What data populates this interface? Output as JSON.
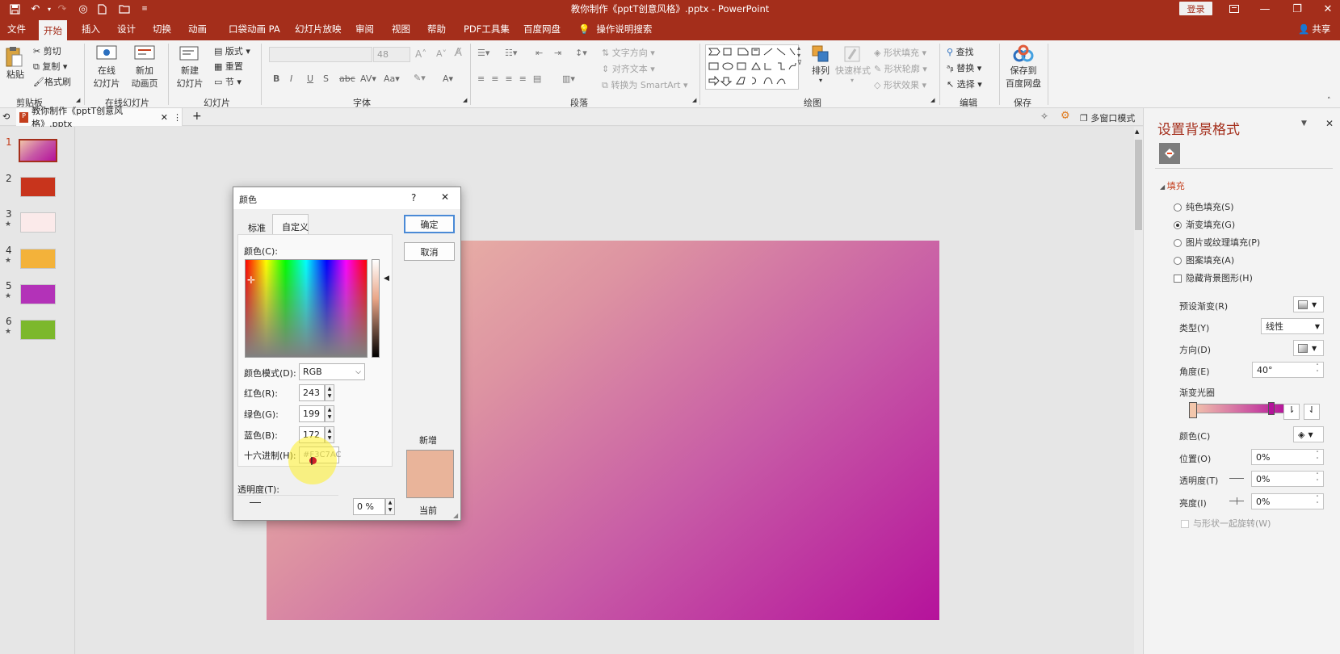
{
  "titlebar": {
    "title": "教你制作《pptT创意风格》.pptx  -  PowerPoint",
    "login": "登录"
  },
  "tabs": [
    {
      "label": "文件"
    },
    {
      "label": "开始"
    },
    {
      "label": "插入"
    },
    {
      "label": "设计"
    },
    {
      "label": "切换"
    },
    {
      "label": "动画"
    },
    {
      "label": "口袋动画 PA"
    },
    {
      "label": "幻灯片放映"
    },
    {
      "label": "审阅"
    },
    {
      "label": "视图"
    },
    {
      "label": "帮助"
    },
    {
      "label": "PDF工具集"
    },
    {
      "label": "百度网盘"
    }
  ],
  "tell_me": "操作说明搜索",
  "share": "共享",
  "ribbon": {
    "clipboard": {
      "paste": "粘贴",
      "cut": "剪切",
      "copy": "复制",
      "format_painter": "格式刷",
      "group": "剪贴板"
    },
    "online": {
      "online_slides_1": "在线",
      "online_slides_2": "幻灯片",
      "new_anim_1": "新加",
      "new_anim_2": "动画页",
      "group": "在线幻灯片"
    },
    "slides": {
      "new_slide_1": "新建",
      "new_slide_2": "幻灯片",
      "layout": "版式",
      "reset": "重置",
      "section": "节",
      "group": "幻灯片"
    },
    "font": {
      "size": "48",
      "group": "字体"
    },
    "paragraph": {
      "text_direction": "文字方向",
      "align_text": "对齐文本",
      "smartart": "转换为 SmartArt",
      "group": "段落"
    },
    "drawing": {
      "arrange": "排列",
      "quick_styles": "快速样式",
      "shape_fill": "形状填充",
      "shape_outline": "形状轮廓",
      "shape_effects": "形状效果",
      "group": "绘图"
    },
    "editing": {
      "find": "查找",
      "replace": "替换",
      "select": "选择",
      "group": "编辑"
    },
    "save": {
      "label_1": "保存到",
      "label_2": "百度网盘",
      "group": "保存"
    }
  },
  "doctab": {
    "name": "教你制作《pptT创意风格》.pptx",
    "multiwindow": "多窗口模式"
  },
  "thumbnails": [
    {
      "num": "1",
      "star": ""
    },
    {
      "num": "2",
      "star": ""
    },
    {
      "num": "3",
      "star": "★"
    },
    {
      "num": "4",
      "star": "★"
    },
    {
      "num": "5",
      "star": "★"
    },
    {
      "num": "6",
      "star": "★"
    }
  ],
  "pane": {
    "title": "设置背景格式",
    "section": "填充",
    "fill_options": [
      {
        "label": "纯色填充(S)",
        "selected": false
      },
      {
        "label": "渐变填充(G)",
        "selected": true
      },
      {
        "label": "图片或纹理填充(P)",
        "selected": false
      },
      {
        "label": "图案填充(A)",
        "selected": false
      }
    ],
    "hide_bg": "隐藏背景图形(H)",
    "preset": "预设渐变(R)",
    "type_label": "类型(Y)",
    "type_value": "线性",
    "direction": "方向(D)",
    "angle_label": "角度(E)",
    "angle_value": "40°",
    "stops": "渐变光圈",
    "color": "颜色(C)",
    "position_label": "位置(O)",
    "position_value": "0%",
    "transparency_label": "透明度(T)",
    "transparency_value": "0%",
    "brightness_label": "亮度(I)",
    "brightness_value": "0%",
    "rotate_with_shape": "与形状一起旋转(W)"
  },
  "dialog": {
    "title": "颜色",
    "help": "?",
    "tab_standard": "标准",
    "tab_custom": "自定义",
    "colors_label": "颜色(C):",
    "ok": "确定",
    "cancel": "取消",
    "mode_label": "颜色模式(D):",
    "mode_value": "RGB",
    "red_label": "红色(R):",
    "red": "243",
    "green_label": "绿色(G):",
    "green": "199",
    "blue_label": "蓝色(B):",
    "blue": "172",
    "hex_label": "十六进制(H):",
    "hex": "#F3C7AC",
    "transparency_label": "透明度(T):",
    "transparency": "0 %",
    "new_label": "新增",
    "current_label": "当前",
    "swatch_color": "#e9b49a"
  }
}
